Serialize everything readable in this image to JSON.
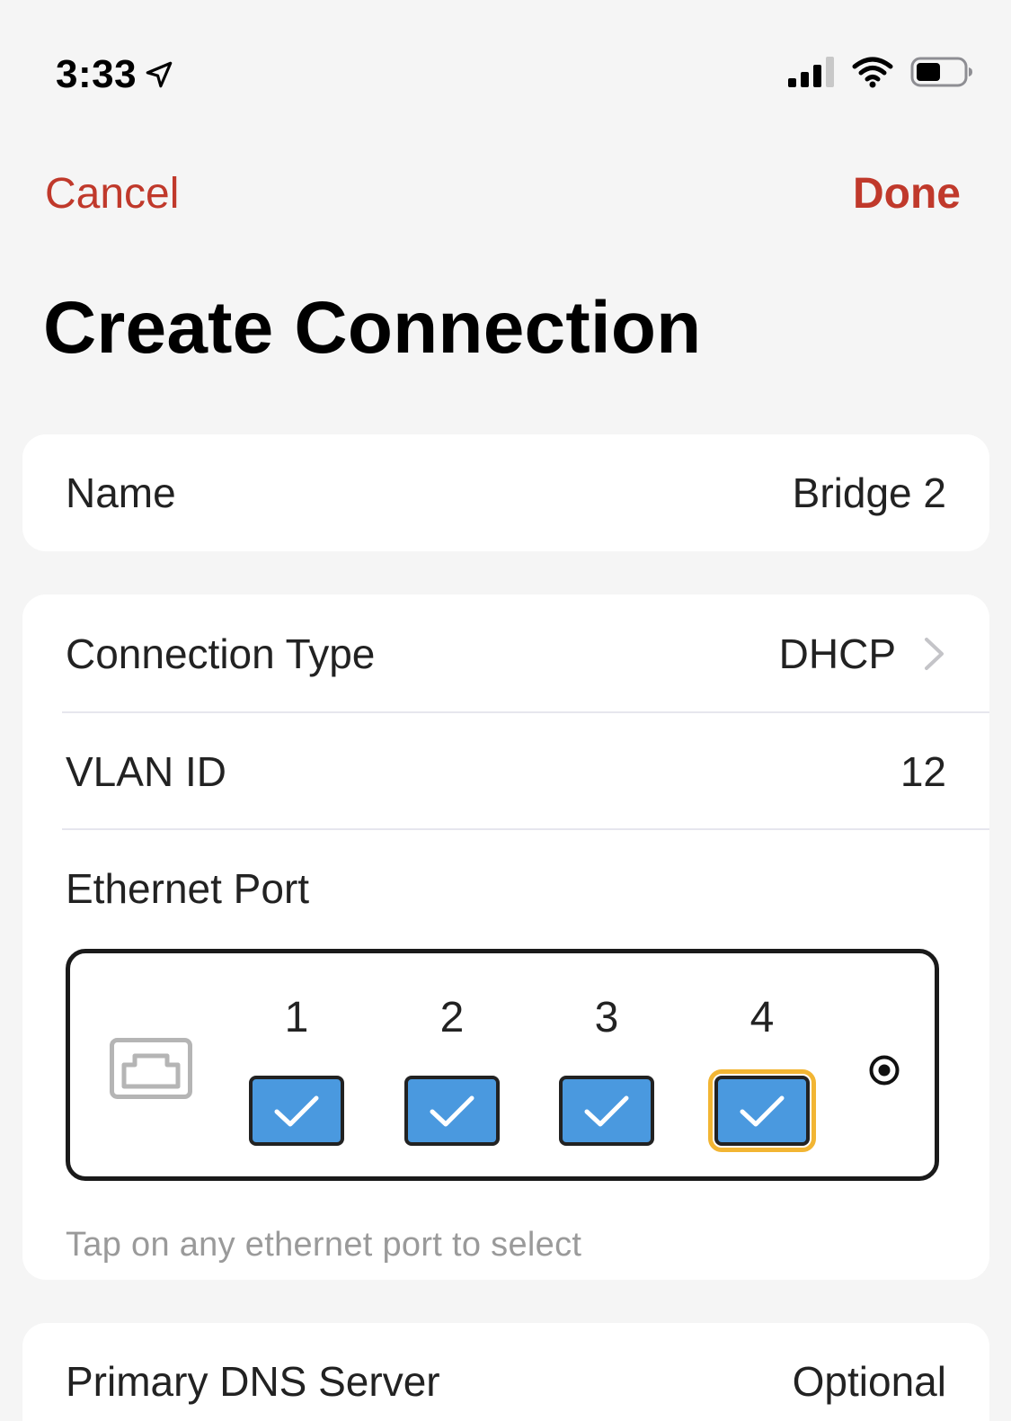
{
  "status_bar": {
    "time": "3:33",
    "icons": [
      "location-arrow-icon",
      "cellular-signal-icon",
      "wifi-icon",
      "battery-icon"
    ]
  },
  "nav": {
    "cancel_label": "Cancel",
    "done_label": "Done"
  },
  "title": "Create Connection",
  "name_row": {
    "label": "Name",
    "value": "Bridge 2"
  },
  "connection_type_row": {
    "label": "Connection Type",
    "value": "DHCP"
  },
  "vlan_row": {
    "label": "VLAN ID",
    "value": "12"
  },
  "ethernet": {
    "label": "Ethernet Port",
    "ports": [
      {
        "number": "1",
        "checked": true
      },
      {
        "number": "2",
        "checked": true
      },
      {
        "number": "3",
        "checked": true
      },
      {
        "number": "4",
        "checked": true,
        "focused": true
      }
    ],
    "hint": "Tap on any ethernet port to select"
  },
  "dns_row": {
    "label": "Primary DNS Server",
    "placeholder": "Optional"
  },
  "colors": {
    "accent": "#c0392b",
    "port_fill": "#4a99df",
    "focus_ring": "#f2b533",
    "background": "#f5f5f5"
  }
}
